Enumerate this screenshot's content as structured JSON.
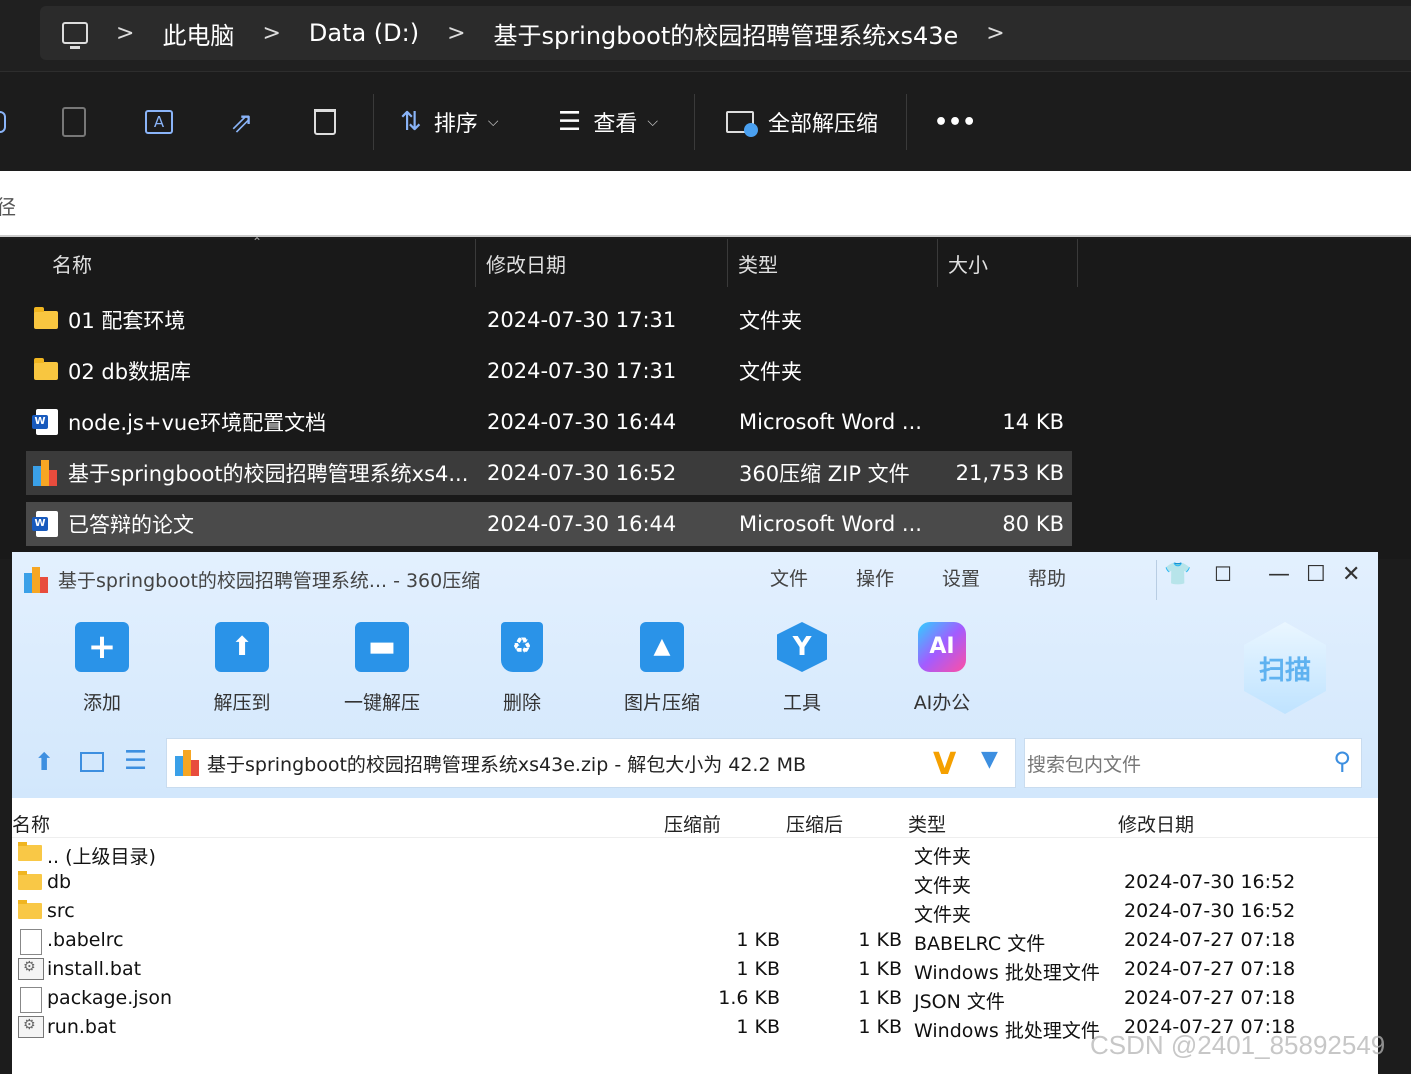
{
  "explorer": {
    "breadcrumbs": [
      "此电脑",
      "Data (D:)",
      "基于springboot的校园招聘管理系统xs43e"
    ],
    "toolbar": {
      "sort_label": "排序",
      "view_label": "查看",
      "extract_all_label": "全部解压缩",
      "more_label": "•••"
    },
    "search_hint": "径",
    "columns": [
      "名称",
      "修改日期",
      "类型",
      "大小"
    ],
    "files": [
      {
        "name": "01 配套环境",
        "date": "2024-07-30 17:31",
        "type": "文件夹",
        "size": "",
        "icon": "folder-icon"
      },
      {
        "name": "02 db数据库",
        "date": "2024-07-30 17:31",
        "type": "文件夹",
        "size": "",
        "icon": "folder-icon"
      },
      {
        "name": "node.js+vue环境配置文档",
        "date": "2024-07-30 16:44",
        "type": "Microsoft Word ...",
        "size": "14 KB",
        "icon": "word-icon"
      },
      {
        "name": "基于springboot的校园招聘管理系统xs4...",
        "date": "2024-07-30 16:52",
        "type": "360压缩 ZIP 文件",
        "size": "21,753 KB",
        "icon": "zip-icon"
      },
      {
        "name": "已答辩的论文",
        "date": "2024-07-30 16:44",
        "type": "Microsoft Word ...",
        "size": "80 KB",
        "icon": "word-icon"
      }
    ]
  },
  "zipwin": {
    "title": "基于springboot的校园招聘管理系统... - 360压缩",
    "menu": [
      "文件",
      "操作",
      "设置",
      "帮助"
    ],
    "tools": [
      "添加",
      "解压到",
      "一键解压",
      "删除",
      "图片压缩",
      "工具",
      "AI办公"
    ],
    "scan_label": "扫描",
    "ai_badge": "AI",
    "path": "基于springboot的校园招聘管理系统xs43e.zip - 解包大小为 42.2 MB",
    "search_placeholder": "搜索包内文件",
    "columns": [
      "名称",
      "压缩前",
      "压缩后",
      "类型",
      "修改日期"
    ],
    "files": [
      {
        "name": ".. (上级目录)",
        "before": "",
        "after": "",
        "type": "文件夹",
        "date": "",
        "icon": "folder-icon"
      },
      {
        "name": "db",
        "before": "",
        "after": "",
        "type": "文件夹",
        "date": "2024-07-30 16:52",
        "icon": "folder-icon"
      },
      {
        "name": "src",
        "before": "",
        "after": "",
        "type": "文件夹",
        "date": "2024-07-30 16:52",
        "icon": "folder-icon"
      },
      {
        "name": ".babelrc",
        "before": "1 KB",
        "after": "1 KB",
        "type": "BABELRC 文件",
        "date": "2024-07-27 07:18",
        "icon": "file-icon"
      },
      {
        "name": "install.bat",
        "before": "1 KB",
        "after": "1 KB",
        "type": "Windows 批处理文件",
        "date": "2024-07-27 07:18",
        "icon": "batch-icon"
      },
      {
        "name": "package.json",
        "before": "1.6 KB",
        "after": "1 KB",
        "type": "JSON 文件",
        "date": "2024-07-27 07:18",
        "icon": "file-icon"
      },
      {
        "name": "run.bat",
        "before": "1 KB",
        "after": "1 KB",
        "type": "Windows 批处理文件",
        "date": "2024-07-27 07:18",
        "icon": "batch-icon"
      }
    ]
  },
  "watermark": "CSDN @2401_85892549"
}
